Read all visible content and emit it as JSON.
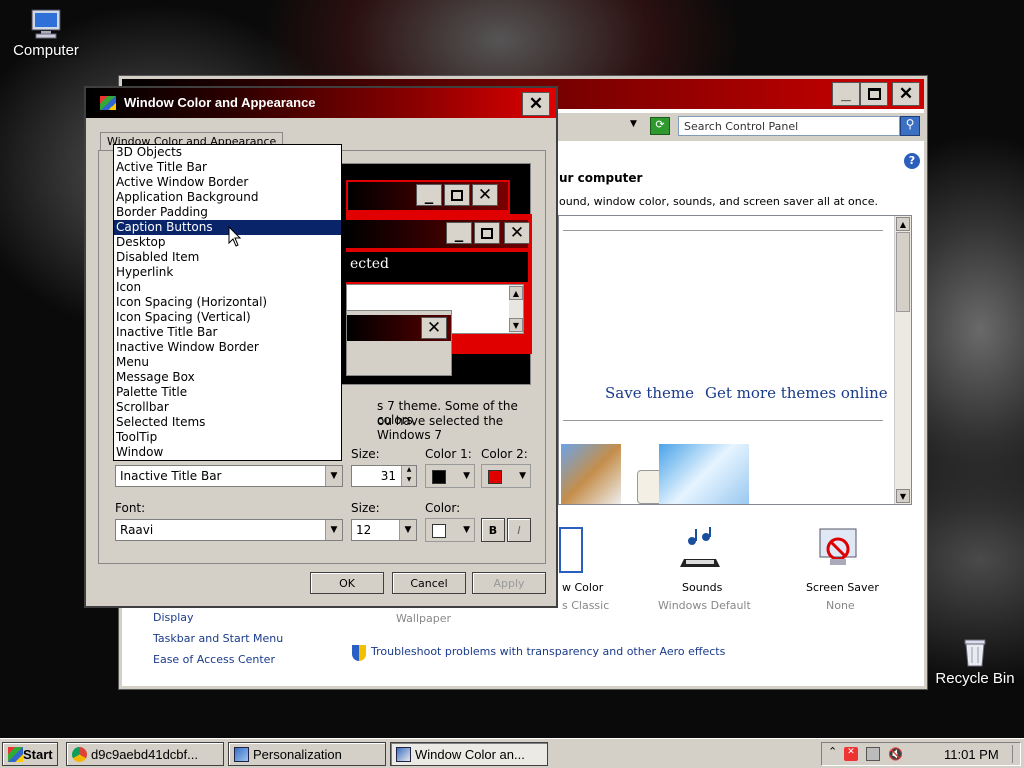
{
  "desktop": {
    "computer_label": "Computer",
    "recycle_label": "Recycle Bin"
  },
  "control_panel": {
    "search_placeholder": "Search Control Panel",
    "heading_fragment": "ur computer",
    "desc_fragment": "ound, window color, sounds, and screen saver all at once.",
    "save_theme": "Save theme",
    "get_more": "Get more themes online",
    "window_color_fragment": "w Color",
    "window_color_sub": "s Classic",
    "sounds_label": "Sounds",
    "sounds_sub": "Windows Default",
    "screensaver_label": "Screen Saver",
    "screensaver_sub": "None",
    "wallpaper_sub": "Wallpaper",
    "side_links": [
      "Display",
      "Taskbar and Start Menu",
      "Ease of Access Center"
    ],
    "troubleshoot": "Troubleshoot problems with transparency and other Aero effects"
  },
  "dialog": {
    "title": "Window Color and Appearance",
    "tab": "Window Color and Appearance",
    "preview_text_fragment": "ected",
    "info_line1": "s 7 theme.  Some of the colors,",
    "info_line2": "ou have selected the Windows 7",
    "item_combo_value": "Inactive Title Bar",
    "size_label": "Size:",
    "size_value": "31",
    "color1_label": "Color 1:",
    "color2_label": "Color 2:",
    "color1": "#000000",
    "color2": "#e00000",
    "font_label": "Font:",
    "font_value": "Raavi",
    "font_size_label": "Size:",
    "font_size_value": "12",
    "font_color_label": "Color:",
    "font_color": "#ffffff",
    "bold_label": "B",
    "italic_label": "I",
    "ok": "OK",
    "cancel": "Cancel",
    "apply": "Apply"
  },
  "dropdown": {
    "options": [
      "3D Objects",
      "Active Title Bar",
      "Active Window Border",
      "Application Background",
      "Border Padding",
      "Caption Buttons",
      "Desktop",
      "Disabled Item",
      "Hyperlink",
      "Icon",
      "Icon Spacing (Horizontal)",
      "Icon Spacing (Vertical)",
      "Inactive Title Bar",
      "Inactive Window Border",
      "Menu",
      "Message Box",
      "Palette Title",
      "Scrollbar",
      "Selected Items",
      "ToolTip",
      "Window"
    ],
    "selected_index": 5
  },
  "taskbar": {
    "start": "Start",
    "tasks": [
      "d9c9aebd41dcbf...",
      "Personalization",
      "Window Color an..."
    ],
    "clock": "11:01 PM"
  },
  "colors": {
    "titlebar_accent": "#e00000",
    "selection": "#0a246a"
  }
}
